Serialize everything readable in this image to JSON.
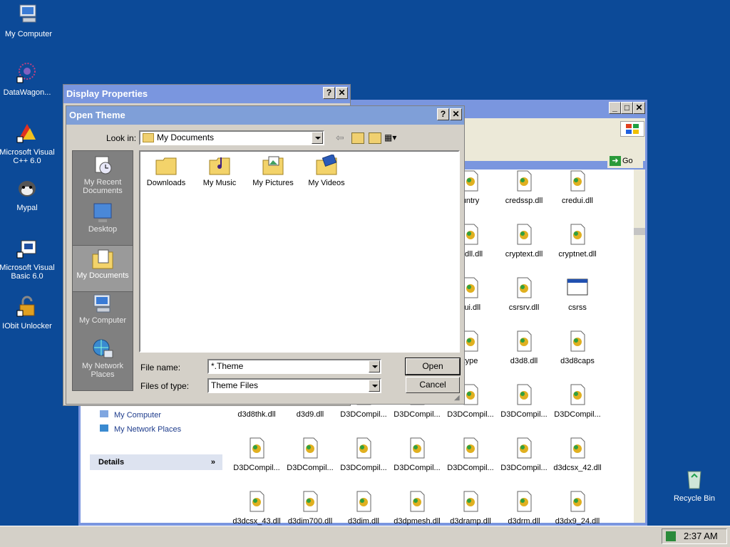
{
  "desktop": {
    "icons": [
      {
        "label": "My Computer"
      },
      {
        "label": "DataWagon..."
      },
      {
        "label": "Microsoft Visual C++ 6.0"
      },
      {
        "label": "Mypal"
      },
      {
        "label": "Microsoft Visual Basic 6.0"
      },
      {
        "label": "IObit Unlocker"
      },
      {
        "label": "Recycle Bin"
      }
    ]
  },
  "explorer": {
    "address_go_label": "Go",
    "side_links": [
      "My Computer",
      "My Network Places"
    ],
    "details_label": "Details",
    "files": [
      [
        "untry",
        "credssp.dll",
        "credui.dll"
      ],
      [
        "otdll.dll",
        "cryptext.dll",
        "cryptnet.dll"
      ],
      [
        "cui.dll",
        "csrsrv.dll",
        "csrss"
      ],
      [
        "type",
        "d3d8.dll",
        "d3d8caps"
      ],
      [
        "d3d8thk.dll",
        "d3d9.dll",
        "D3DCompil...",
        "D3DCompil...",
        "D3DCompil...",
        "D3DCompil...",
        "D3DCompil..."
      ],
      [
        "D3DCompil...",
        "D3DCompil...",
        "D3DCompil...",
        "D3DCompil...",
        "D3DCompil...",
        "D3DCompil...",
        "d3dcsx_42.dll"
      ],
      [
        "d3dcsx_43.dll",
        "d3dim700.dll",
        "d3dim.dll",
        "d3dpmesh.dll",
        "d3dramp.dll",
        "d3drm.dll",
        "d3dx9_24.dll"
      ]
    ]
  },
  "display_properties": {
    "title": "Display Properties",
    "help": "?",
    "close": "✕"
  },
  "open_theme": {
    "title": "Open Theme",
    "help": "?",
    "close": "✕",
    "look_in_label": "Look in:",
    "look_in_value": "My Documents",
    "places": [
      {
        "label": "My Recent Documents"
      },
      {
        "label": "Desktop"
      },
      {
        "label": "My Documents"
      },
      {
        "label": "My Computer"
      },
      {
        "label": "My Network Places"
      }
    ],
    "folders": [
      {
        "label": "Downloads"
      },
      {
        "label": "My Music"
      },
      {
        "label": "My Pictures"
      },
      {
        "label": "My Videos"
      }
    ],
    "file_name_label": "File name:",
    "file_name_value": "*.Theme",
    "files_of_type_label": "Files of type:",
    "files_of_type_value": "Theme Files",
    "open_button": "Open",
    "cancel_button": "Cancel"
  },
  "taskbar": {
    "time": "2:37 AM"
  },
  "colors": {
    "desktop": "#0c4a98",
    "inactive_title": "#7a96df",
    "active_title": "#7f9fd8",
    "places_bar": "#808080"
  }
}
